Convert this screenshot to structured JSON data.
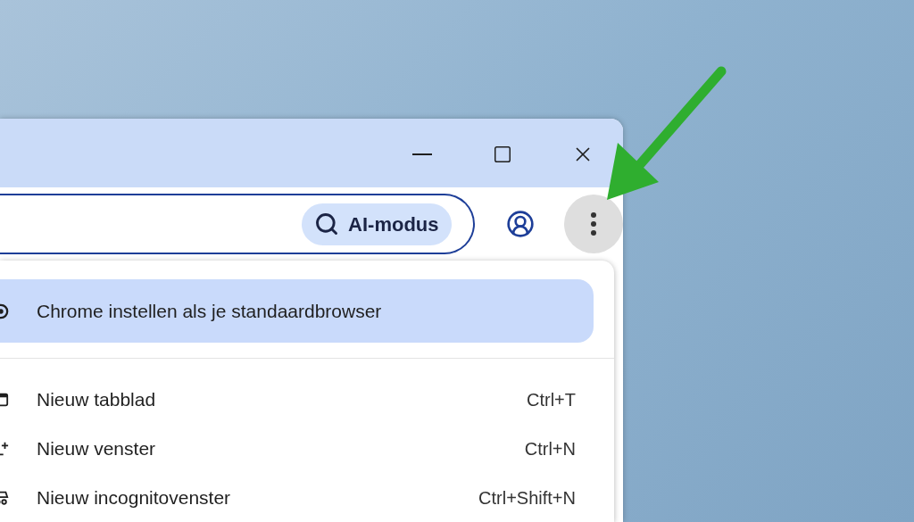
{
  "window_controls": [
    {
      "kind": "minimize"
    },
    {
      "kind": "maximize"
    },
    {
      "kind": "close"
    }
  ],
  "toolbar": {
    "ai_mode": {
      "label": "AI-modus"
    }
  },
  "menu": {
    "items": [
      {
        "kind": "chrome",
        "label": "Chrome instellen als je standaardbrowser",
        "selected": true,
        "separator_after": true
      },
      {
        "kind": "tab",
        "label": "Nieuw tabblad",
        "shortcut": "Ctrl+T",
        "selected": false
      },
      {
        "kind": "window",
        "label": "Nieuw venster",
        "shortcut": "Ctrl+N",
        "selected": false
      },
      {
        "kind": "incognito",
        "label": "Nieuw incognitovenster",
        "shortcut": "Ctrl+Shift+N",
        "selected": false
      }
    ]
  }
}
